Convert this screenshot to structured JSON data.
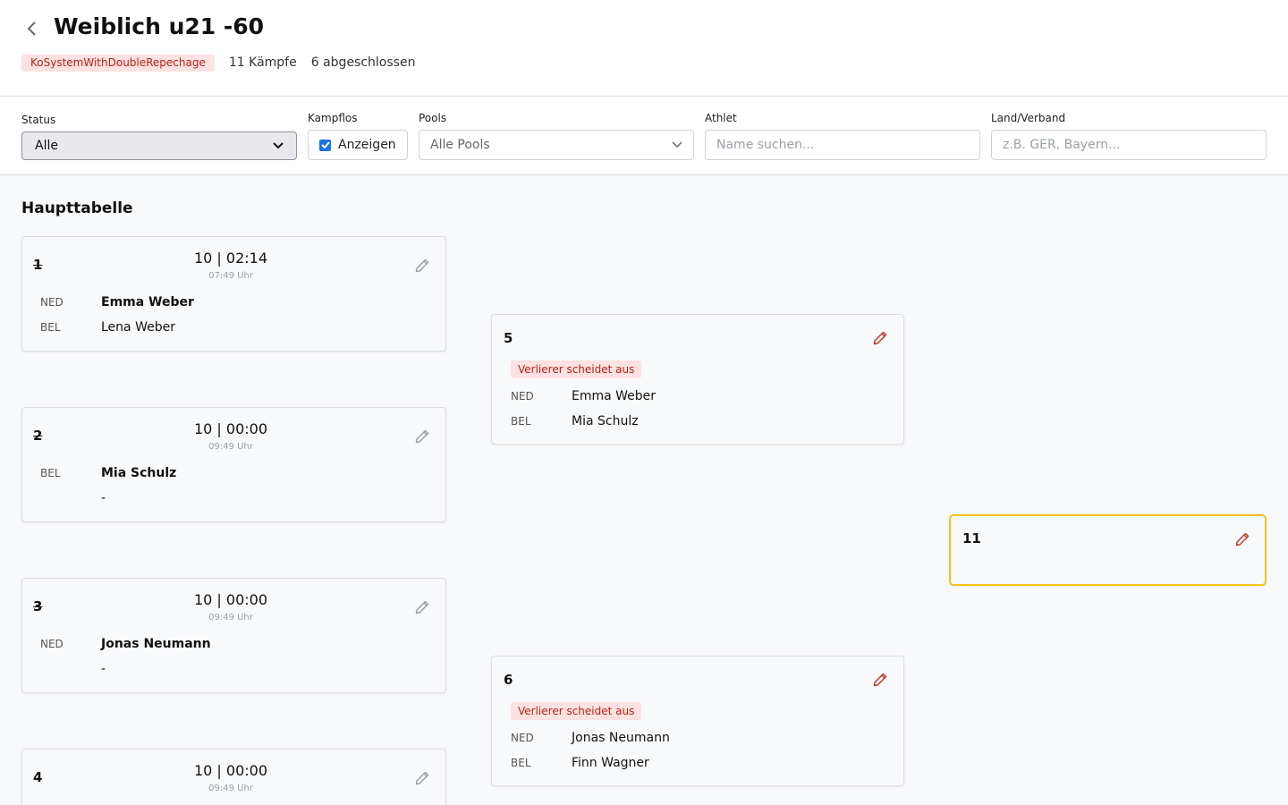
{
  "header": {
    "title": "Weiblich u21 -60",
    "system_badge": "KoSystemWithDoubleRepechage",
    "fights_count": "11 Kämpfe",
    "completed_count": "6 abgeschlossen"
  },
  "filters": {
    "status": {
      "label": "Status",
      "value": "Alle"
    },
    "kampflos": {
      "label": "Kampflos",
      "checkbox_label": "Anzeigen",
      "checked": true
    },
    "pools": {
      "label": "Pools",
      "value": "Alle Pools"
    },
    "athlet": {
      "label": "Athlet",
      "placeholder": "Name suchen..."
    },
    "land": {
      "label": "Land/Verband",
      "placeholder": "z.B. GER, Bayern..."
    }
  },
  "section": {
    "title": "Haupttabelle"
  },
  "matches": [
    {
      "number": "1",
      "struck": true,
      "time": "10 | 02:14",
      "clock": "07:49 Uhr",
      "fighters": [
        {
          "country": "NED",
          "name": "Emma Weber",
          "winner": true
        },
        {
          "country": "BEL",
          "name": "Lena Weber",
          "winner": false
        }
      ]
    },
    {
      "number": "2",
      "struck": true,
      "time": "10 | 00:00",
      "clock": "09:49 Uhr",
      "fighters": [
        {
          "country": "BEL",
          "name": "Mia Schulz",
          "winner": true
        },
        {
          "country": "",
          "name": "-",
          "winner": false
        }
      ]
    },
    {
      "number": "3",
      "struck": true,
      "time": "10 | 00:00",
      "clock": "09:49 Uhr",
      "fighters": [
        {
          "country": "NED",
          "name": "Jonas Neumann",
          "winner": true
        },
        {
          "country": "",
          "name": "-",
          "winner": false
        }
      ]
    },
    {
      "number": "4",
      "struck": false,
      "time": "10 | 00:00",
      "clock": "09:49 Uhr",
      "fighters": []
    },
    {
      "number": "5",
      "badge": "Verlierer scheidet aus",
      "fighters": [
        {
          "country": "NED",
          "name": "Emma Weber"
        },
        {
          "country": "BEL",
          "name": "Mia Schulz"
        }
      ]
    },
    {
      "number": "6",
      "badge": "Verlierer scheidet aus",
      "fighters": [
        {
          "country": "NED",
          "name": "Jonas Neumann"
        },
        {
          "country": "BEL",
          "name": "Finn Wagner"
        }
      ]
    },
    {
      "number": "11",
      "highlighted": true,
      "fighters": []
    }
  ],
  "colors": {
    "badge_bg": "#fde2e1",
    "badge_text": "#b42318",
    "edit_active": "#c0392b",
    "edit_inactive": "#9aa0a6",
    "highlight_border": "#f0c419"
  },
  "icons": {
    "back": "chevron-left-icon",
    "edit": "pencil-icon",
    "dropdown": "chevron-down-icon",
    "check": "check-icon"
  }
}
